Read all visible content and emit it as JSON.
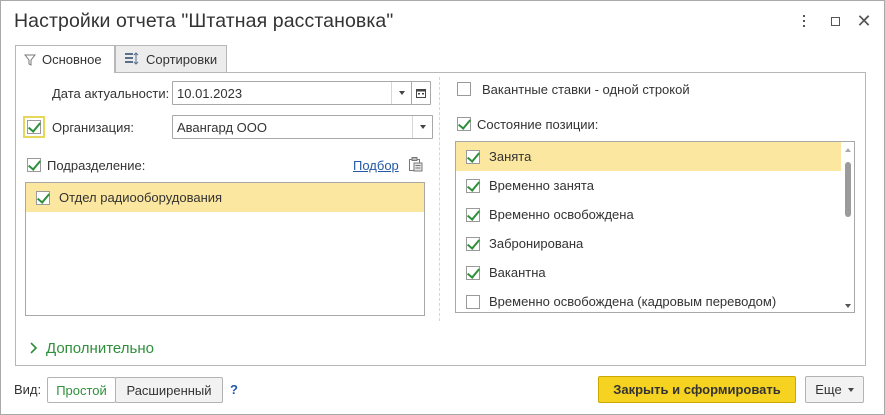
{
  "window": {
    "title": "Настройки отчета \"Штатная расстановка\""
  },
  "tabs": [
    {
      "label": "Основное",
      "icon": "filter-icon",
      "active": true
    },
    {
      "label": "Сортировки",
      "icon": "sort-icon",
      "active": false
    }
  ],
  "left": {
    "date_label": "Дата актуальности:",
    "date_value": "10.01.2023",
    "org_label": "Организация:",
    "org_value": "Авангард ООО",
    "org_checked": true,
    "dept_label": "Подразделение:",
    "dept_checked": true,
    "pick_link": "Подбор",
    "dept_items": [
      {
        "label": "Отдел радиооборудования",
        "checked": true,
        "selected": true
      }
    ]
  },
  "right": {
    "vacancy_label": "Вакантные ставки - одной строкой",
    "vacancy_checked": false,
    "state_label": "Состояние позиции:",
    "state_checked": true,
    "states": [
      {
        "label": "Занята",
        "checked": true,
        "selected": true
      },
      {
        "label": "Временно занята",
        "checked": true,
        "selected": false
      },
      {
        "label": "Временно освобождена",
        "checked": true,
        "selected": false
      },
      {
        "label": "Забронирована",
        "checked": true,
        "selected": false
      },
      {
        "label": "Вакантна",
        "checked": true,
        "selected": false
      },
      {
        "label": "Временно освобождена (кадровым переводом)",
        "checked": false,
        "selected": false
      }
    ]
  },
  "extra": {
    "label": "Дополнительно"
  },
  "footer": {
    "view_label": "Вид:",
    "simple_label": "Простой",
    "extended_label": "Расширенный",
    "help_label": "?",
    "close_build_label": "Закрыть и сформировать",
    "more_label": "Еще"
  },
  "colors": {
    "accent_green": "#2f8f3b",
    "selection": "#fbe7a0",
    "primary_button": "#f7d321",
    "link": "#2459a6"
  }
}
